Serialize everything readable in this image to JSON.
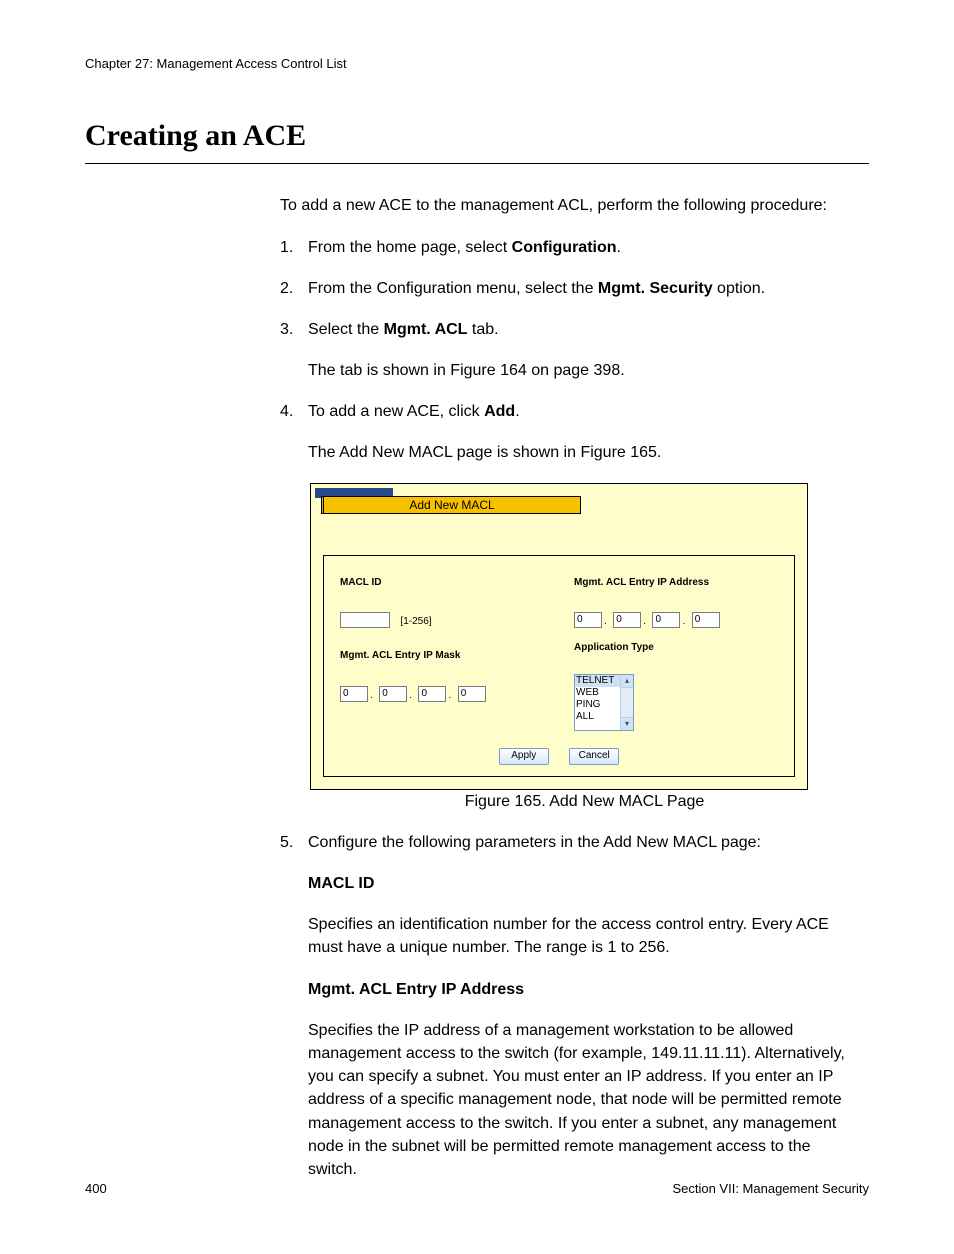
{
  "header": {
    "chapter_line": "Chapter 27: Management Access Control List"
  },
  "section": {
    "title": "Creating an ACE"
  },
  "intro": "To add a new ACE to the management ACL, perform the following procedure:",
  "steps": [
    {
      "n": "1.",
      "pre": "From the home page, select ",
      "bold": "Configuration",
      "post": "."
    },
    {
      "n": "2.",
      "pre": "From the Configuration menu, select the ",
      "bold": "Mgmt. Security",
      "post": " option."
    },
    {
      "n": "3.",
      "pre": "Select the ",
      "bold": "Mgmt. ACL",
      "post": " tab.",
      "sub": "The tab is shown in Figure 164 on page 398."
    },
    {
      "n": "4.",
      "pre": "To add a new ACE, click ",
      "bold": "Add",
      "post": ".",
      "sub": "The Add New MACL page is shown in Figure 165."
    }
  ],
  "figure": {
    "tab_title": "Add New MACL",
    "fields": {
      "macl_id_label": "MACL ID",
      "macl_id_value": "",
      "macl_id_hint": "[1-256]",
      "mask_label": "Mgmt. ACL Entry IP Mask",
      "mask_octets": [
        "0",
        "0",
        "0",
        "0"
      ],
      "addr_label": "Mgmt. ACL Entry IP Address",
      "addr_octets": [
        "0",
        "0",
        "0",
        "0"
      ],
      "apptype_label": "Application Type",
      "apptype_options": [
        "TELNET",
        "WEB",
        "PING",
        "ALL"
      ]
    },
    "buttons": {
      "apply": "Apply",
      "cancel": "Cancel"
    },
    "caption": "Figure 165. Add New MACL Page"
  },
  "step5": {
    "n": "5.",
    "text": "Configure the following parameters in the Add New MACL page:"
  },
  "params": {
    "p1_title": "MACL ID",
    "p1_body": "Specifies an identification number for the access control entry. Every ACE must have a unique number. The range is 1 to 256.",
    "p2_title": "Mgmt. ACL Entry IP Address",
    "p2_body": "Specifies the IP address of a management workstation to be allowed management access to the switch (for example, 149.11.11.11). Alternatively, you can specify a subnet. You must enter an IP address. If you enter an IP address of a specific management node, that node will be permitted remote management access to the switch. If you enter a subnet, any management node in the subnet will be permitted remote management access to the switch."
  },
  "footer": {
    "page_no": "400",
    "section_label": "Section VII: Management Security"
  }
}
